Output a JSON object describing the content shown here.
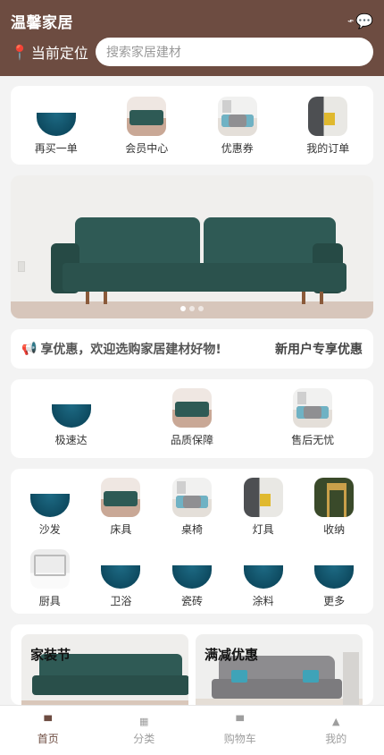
{
  "colors": {
    "brand": "#6d4c41",
    "background": "#f3f3f3",
    "tab_inactive": "#9e9e9e"
  },
  "header": {
    "title": "温馨家居",
    "location_label": "当前定位",
    "search_placeholder": "搜索家居建材"
  },
  "quick_entries": [
    {
      "label": "再买一单",
      "thumb": "t-blue"
    },
    {
      "label": "会员中心",
      "thumb": "t-sofa"
    },
    {
      "label": "优惠券",
      "thumb": "t-gray"
    },
    {
      "label": "我的订单",
      "thumb": "t-dark"
    }
  ],
  "banner": {
    "slides": 3,
    "active_index": 0
  },
  "notice": {
    "text": "享优惠，欢迎选购家居建材好物!",
    "tag": "新用户专享优惠"
  },
  "services": [
    {
      "label": "极速达",
      "thumb": "t-blue"
    },
    {
      "label": "品质保障",
      "thumb": "t-sofa"
    },
    {
      "label": "售后无忧",
      "thumb": "t-gray"
    }
  ],
  "categories": [
    {
      "label": "沙发",
      "thumb": "t-blue"
    },
    {
      "label": "床具",
      "thumb": "t-sofa"
    },
    {
      "label": "桌椅",
      "thumb": "t-gray"
    },
    {
      "label": "灯具",
      "thumb": "t-dark"
    },
    {
      "label": "收纳",
      "thumb": "t-chair"
    },
    {
      "label": "厨具",
      "thumb": "t-kitchen"
    },
    {
      "label": "卫浴",
      "thumb": "t-blue"
    },
    {
      "label": "瓷砖",
      "thumb": "t-blue"
    },
    {
      "label": "涂料",
      "thumb": "t-blue"
    },
    {
      "label": "更多",
      "thumb": "t-blue"
    }
  ],
  "promos": [
    {
      "title": "家装节"
    },
    {
      "title": "满减优惠"
    }
  ],
  "tabs": [
    {
      "label": "首页",
      "icon": "home-icon",
      "active": true
    },
    {
      "label": "分类",
      "icon": "grid-icon",
      "active": false
    },
    {
      "label": "购物车",
      "icon": "cart-icon",
      "active": false
    },
    {
      "label": "我的",
      "icon": "user-icon",
      "active": false
    }
  ]
}
